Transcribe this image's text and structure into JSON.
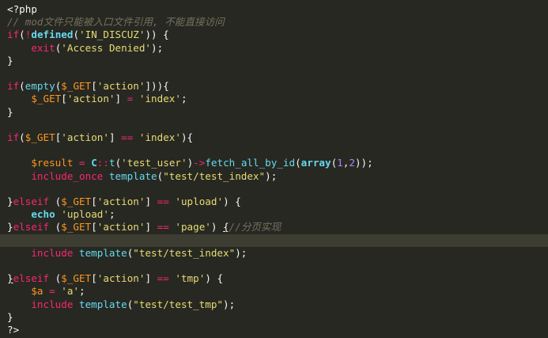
{
  "theme": {
    "background": "#272822",
    "current_line": "#3e3d32",
    "colors": {
      "default": "#f8f8f2",
      "keyword": "#f92672",
      "function": "#66d9ef",
      "string": "#e6db74",
      "number": "#ae81ff",
      "variable": "#fd971f",
      "comment": "#75715e"
    }
  },
  "editor": {
    "language": "php",
    "current_line_number": 19,
    "lines": [
      [
        [
          "tag",
          "<?php"
        ]
      ],
      [
        [
          "comment",
          "// mod文件只能被入口文件引用, 不能直接访问"
        ]
      ],
      [
        [
          "keyword",
          "if"
        ],
        [
          "default",
          "("
        ],
        [
          "keyword",
          "!"
        ],
        [
          "func-bold",
          "defined"
        ],
        [
          "default",
          "("
        ],
        [
          "string",
          "'IN_DISCUZ'"
        ],
        [
          "default",
          ")) {"
        ]
      ],
      [
        [
          "default",
          "    "
        ],
        [
          "keyword",
          "exit"
        ],
        [
          "default",
          "("
        ],
        [
          "string",
          "'Access Denied'"
        ],
        [
          "default",
          ");"
        ]
      ],
      [
        [
          "default",
          "}"
        ]
      ],
      [],
      [
        [
          "keyword",
          "if"
        ],
        [
          "default",
          "("
        ],
        [
          "func",
          "empty"
        ],
        [
          "default",
          "("
        ],
        [
          "var",
          "$_GET"
        ],
        [
          "default",
          "["
        ],
        [
          "string",
          "'action'"
        ],
        [
          "default",
          "])){"
        ]
      ],
      [
        [
          "default",
          "    "
        ],
        [
          "var",
          "$_GET"
        ],
        [
          "default",
          "["
        ],
        [
          "string",
          "'action'"
        ],
        [
          "default",
          "] "
        ],
        [
          "keyword",
          "="
        ],
        [
          "default",
          " "
        ],
        [
          "string",
          "'index'"
        ],
        [
          "default",
          ";"
        ]
      ],
      [
        [
          "default",
          "}"
        ]
      ],
      [],
      [
        [
          "keyword",
          "if"
        ],
        [
          "default",
          "("
        ],
        [
          "var",
          "$_GET"
        ],
        [
          "default",
          "["
        ],
        [
          "string",
          "'action'"
        ],
        [
          "default",
          "] "
        ],
        [
          "keyword",
          "=="
        ],
        [
          "default",
          " "
        ],
        [
          "string",
          "'index'"
        ],
        [
          "default",
          "){"
        ]
      ],
      [],
      [
        [
          "default",
          "    "
        ],
        [
          "var",
          "$result"
        ],
        [
          "default",
          " "
        ],
        [
          "keyword",
          "="
        ],
        [
          "default",
          " "
        ],
        [
          "class",
          "C"
        ],
        [
          "keyword",
          "::"
        ],
        [
          "func",
          "t"
        ],
        [
          "default",
          "("
        ],
        [
          "string",
          "'test_user'"
        ],
        [
          "default",
          ")"
        ],
        [
          "keyword",
          "->"
        ],
        [
          "func",
          "fetch_all_by_id"
        ],
        [
          "default",
          "("
        ],
        [
          "func-bold",
          "array"
        ],
        [
          "default",
          "("
        ],
        [
          "number",
          "1"
        ],
        [
          "default",
          ","
        ],
        [
          "number",
          "2"
        ],
        [
          "default",
          "));"
        ]
      ],
      [
        [
          "default",
          "    "
        ],
        [
          "keyword",
          "include_once"
        ],
        [
          "default",
          " "
        ],
        [
          "func",
          "template"
        ],
        [
          "default",
          "("
        ],
        [
          "string",
          "\"test/test_index\""
        ],
        [
          "default",
          ");"
        ]
      ],
      [],
      [
        [
          "default",
          "}"
        ],
        [
          "keyword",
          "elseif"
        ],
        [
          "default",
          " ("
        ],
        [
          "var",
          "$_GET"
        ],
        [
          "default",
          "["
        ],
        [
          "string",
          "'action'"
        ],
        [
          "default",
          "] "
        ],
        [
          "keyword",
          "=="
        ],
        [
          "default",
          " "
        ],
        [
          "string",
          "'upload'"
        ],
        [
          "default",
          ") {"
        ]
      ],
      [
        [
          "default",
          "    "
        ],
        [
          "func-bold",
          "echo"
        ],
        [
          "default",
          " "
        ],
        [
          "string",
          "'upload'"
        ],
        [
          "default",
          ";"
        ]
      ],
      [
        [
          "default",
          "}"
        ],
        [
          "keyword",
          "elseif"
        ],
        [
          "default",
          " ("
        ],
        [
          "var",
          "$_GET"
        ],
        [
          "default",
          "["
        ],
        [
          "string",
          "'action'"
        ],
        [
          "default",
          "] "
        ],
        [
          "keyword",
          "=="
        ],
        [
          "default",
          " "
        ],
        [
          "string",
          "'page'"
        ],
        [
          "default",
          ") "
        ],
        [
          "default-under",
          "{"
        ],
        [
          "comment",
          "//分页实现"
        ]
      ],
      [],
      [
        [
          "default",
          "    "
        ],
        [
          "keyword",
          "include"
        ],
        [
          "default",
          " "
        ],
        [
          "func",
          "template"
        ],
        [
          "default",
          "("
        ],
        [
          "string",
          "\"test/test_index\""
        ],
        [
          "default",
          ");"
        ]
      ],
      [],
      [
        [
          "default-under",
          "}"
        ],
        [
          "keyword",
          "elseif"
        ],
        [
          "default",
          " ("
        ],
        [
          "var",
          "$_GET"
        ],
        [
          "default",
          "["
        ],
        [
          "string",
          "'action'"
        ],
        [
          "default",
          "] "
        ],
        [
          "keyword",
          "=="
        ],
        [
          "default",
          " "
        ],
        [
          "string",
          "'tmp'"
        ],
        [
          "default",
          ") {"
        ]
      ],
      [
        [
          "default",
          "    "
        ],
        [
          "var",
          "$a"
        ],
        [
          "default",
          " "
        ],
        [
          "keyword",
          "="
        ],
        [
          "default",
          " "
        ],
        [
          "string",
          "'a'"
        ],
        [
          "default",
          ";"
        ]
      ],
      [
        [
          "default",
          "    "
        ],
        [
          "keyword",
          "include"
        ],
        [
          "default",
          " "
        ],
        [
          "func",
          "template"
        ],
        [
          "default",
          "("
        ],
        [
          "string",
          "\"test/test_tmp\""
        ],
        [
          "default",
          ");"
        ]
      ],
      [
        [
          "default",
          "}"
        ]
      ],
      [
        [
          "tag",
          "?>"
        ]
      ]
    ]
  }
}
